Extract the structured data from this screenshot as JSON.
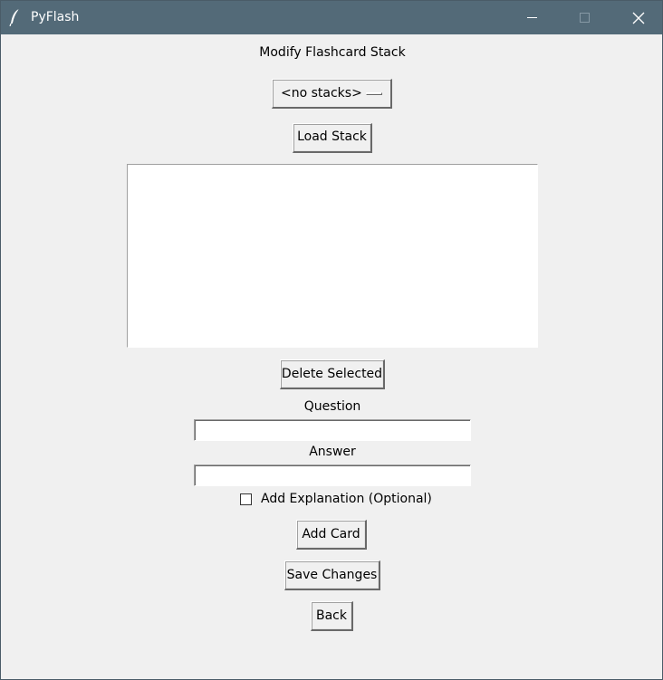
{
  "window": {
    "title": "PyFlash",
    "controls": {
      "minimize": "minimize-icon",
      "maximize": "maximize-icon",
      "close": "close-icon"
    }
  },
  "colors": {
    "titlebar": "#536a78",
    "background": "#f0f0f0",
    "field": "#ffffff"
  },
  "heading": "Modify Flashcard Stack",
  "stack_select": {
    "selected": "<no stacks>"
  },
  "buttons": {
    "load_stack": "Load Stack",
    "delete_selected": "Delete Selected",
    "add_card": "Add Card",
    "save_changes": "Save Changes",
    "back": "Back"
  },
  "cards_list": {
    "items": []
  },
  "form": {
    "question_label": "Question",
    "question_value": "",
    "answer_label": "Answer",
    "answer_value": "",
    "explanation_label": "Add Explanation (Optional)",
    "explanation_checked": false
  }
}
